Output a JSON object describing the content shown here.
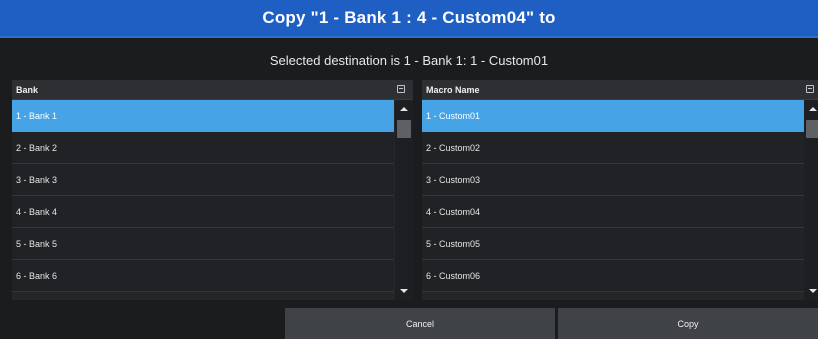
{
  "dialog": {
    "title": "Copy \"1 - Bank 1 : 4 - Custom04\" to",
    "destination_text": "Selected destination is 1 - Bank 1: 1 - Custom01"
  },
  "bank_panel": {
    "header": "Bank",
    "items": [
      "1 - Bank 1",
      "2 - Bank 2",
      "3 - Bank 3",
      "4 - Bank 4",
      "5 - Bank 5",
      "6 - Bank 6"
    ],
    "selected_index": 0
  },
  "macro_panel": {
    "header": "Macro Name",
    "items": [
      "1 - Custom01",
      "2 - Custom02",
      "3 - Custom03",
      "4 - Custom04",
      "5 - Custom05",
      "6 - Custom06"
    ],
    "selected_index": 0
  },
  "buttons": {
    "cancel": "Cancel",
    "copy": "Copy"
  },
  "colors": {
    "title_bar": "#1f5fc4",
    "selected_row": "#45a3e6",
    "background": "#1b1c1e"
  },
  "icons": {
    "column_options": "column-options-icon",
    "scroll_up": "scroll-up-arrow-icon",
    "scroll_down": "scroll-down-arrow-icon"
  }
}
